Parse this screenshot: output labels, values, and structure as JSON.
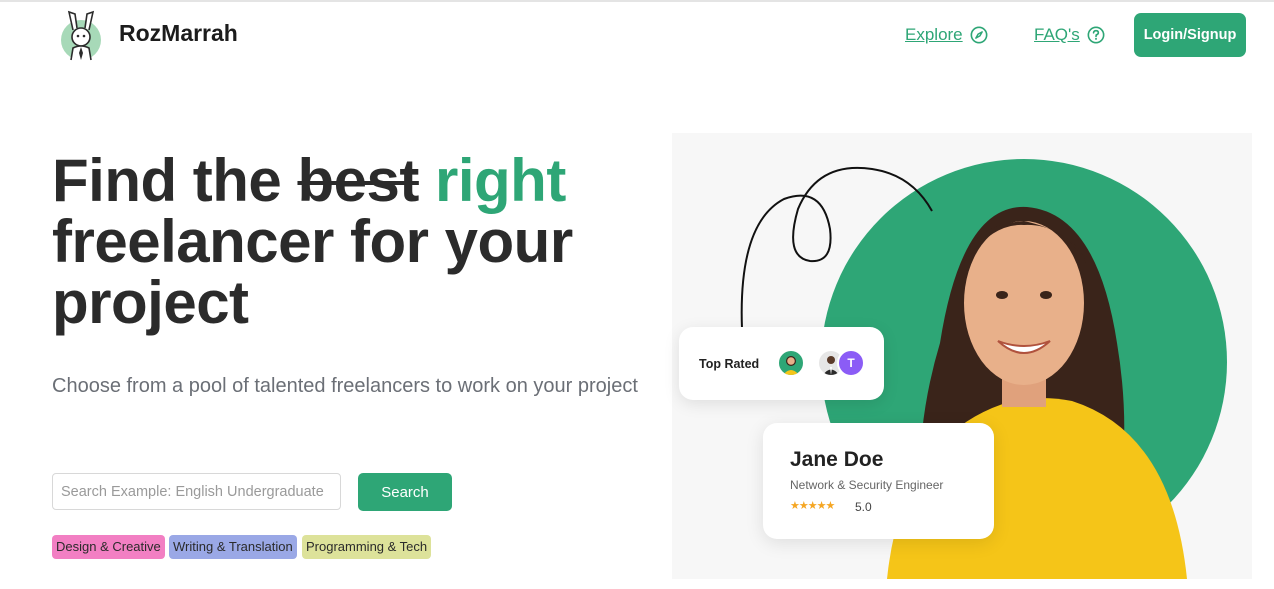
{
  "header": {
    "brand": "RozMarrah",
    "nav": {
      "explore": "Explore",
      "faq": "FAQ's",
      "login": "Login/Signup"
    }
  },
  "hero": {
    "headline_part1": "Find the ",
    "headline_strike": "best",
    "headline_accent": "right",
    "headline_part2": "freelancer for your project",
    "subtitle": "Choose from a pool of talented freelancers to work on your project",
    "search": {
      "placeholder": "Search Example: English Undergraduate",
      "value": "",
      "button": "Search"
    },
    "tags": [
      {
        "label": "Design & Creative",
        "color": "#f27fc3"
      },
      {
        "label": "Writing & Translation",
        "color": "#9aa8e6"
      },
      {
        "label": "Programming & Tech",
        "color": "#dde29a"
      }
    ]
  },
  "illustration": {
    "top_rated_label": "Top Rated",
    "avatar_initial": "T",
    "person": {
      "name": "Jane Doe",
      "role": "Network & Security Engineer",
      "stars": "★★★★★",
      "rating": "5.0"
    }
  },
  "colors": {
    "accent": "#2ea676",
    "star": "#f5a623",
    "avatar_purple": "#8b5cf6",
    "sweater": "#f5c518"
  },
  "icons": {
    "logo": "rabbit-mascot-icon",
    "explore": "compass-icon",
    "faq": "question-circle-icon"
  }
}
